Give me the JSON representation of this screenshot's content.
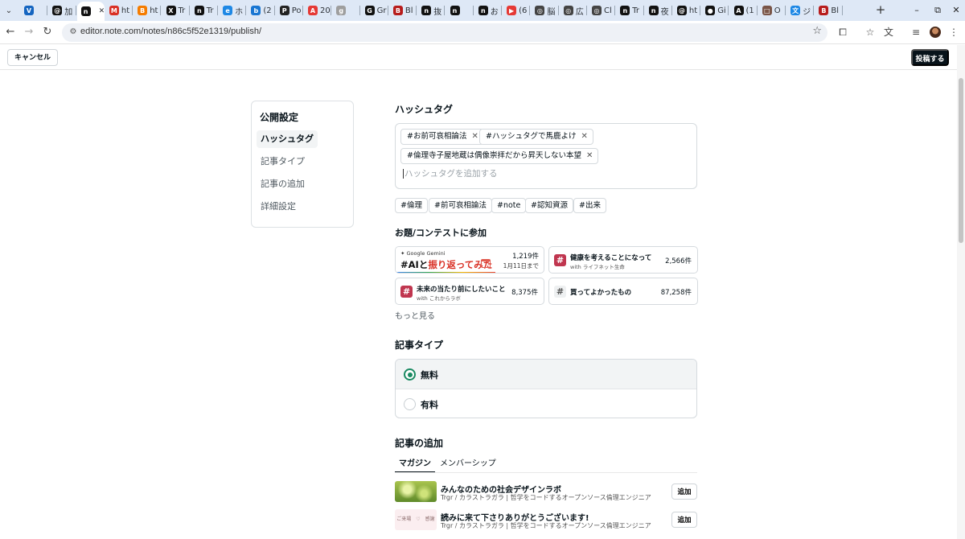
{
  "browser": {
    "tabs": [
      {
        "label": "",
        "icon": "vpn-icon",
        "color": "#1565c0",
        "glyph": "V"
      },
      {
        "label": "加",
        "icon": "threads-icon",
        "color": "#111111",
        "glyph": "@"
      },
      {
        "label": "",
        "icon": "note-icon",
        "color": "#111111",
        "glyph": "n",
        "active": true
      },
      {
        "label": "ht",
        "icon": "gmail-icon",
        "color": "#d93025",
        "glyph": "M"
      },
      {
        "label": "ht",
        "icon": "blogger-icon",
        "color": "#f57c00",
        "glyph": "B"
      },
      {
        "label": "Tr",
        "icon": "x-icon",
        "color": "#111111",
        "glyph": "X"
      },
      {
        "label": "Tr",
        "icon": "note-icon",
        "color": "#111111",
        "glyph": "n"
      },
      {
        "label": "ホ",
        "icon": "edge-icon",
        "color": "#1e88e5",
        "glyph": "e"
      },
      {
        "label": "(2",
        "icon": "bluesky-icon",
        "color": "#1976d2",
        "glyph": "b"
      },
      {
        "label": "Po",
        "icon": "perplexity-icon",
        "color": "#222222",
        "glyph": "P"
      },
      {
        "label": "20",
        "icon": "app-icon",
        "color": "#e53935",
        "glyph": "A"
      },
      {
        "label": "",
        "icon": "globe-icon",
        "color": "#9e9e9e",
        "glyph": "g"
      },
      {
        "label": "Gr",
        "icon": "grok-icon",
        "color": "#111111",
        "glyph": "G"
      },
      {
        "label": "Bl",
        "icon": "bookmark-icon",
        "color": "#b71c1c",
        "glyph": "B"
      },
      {
        "label": "抜",
        "icon": "note-icon",
        "color": "#111111",
        "glyph": "n"
      },
      {
        "label": "",
        "icon": "note-icon",
        "color": "#111111",
        "glyph": "n"
      },
      {
        "label": "お",
        "icon": "note-icon",
        "color": "#111111",
        "glyph": "n"
      },
      {
        "label": "(6",
        "icon": "youtube-icon",
        "color": "#e53935",
        "glyph": "▶"
      },
      {
        "label": "脳",
        "icon": "openai-icon",
        "color": "#444444",
        "glyph": "◎"
      },
      {
        "label": "広",
        "icon": "openai-icon",
        "color": "#444444",
        "glyph": "◎"
      },
      {
        "label": "Cl",
        "icon": "openai-icon",
        "color": "#444444",
        "glyph": "◎"
      },
      {
        "label": "Tr",
        "icon": "note-icon",
        "color": "#111111",
        "glyph": "n"
      },
      {
        "label": "夜",
        "icon": "note-icon",
        "color": "#111111",
        "glyph": "n"
      },
      {
        "label": "ht",
        "icon": "threads-icon",
        "color": "#111111",
        "glyph": "@"
      },
      {
        "label": "Gi",
        "icon": "github-icon",
        "color": "#111111",
        "glyph": "●"
      },
      {
        "label": "(1",
        "icon": "font-a-icon",
        "color": "#111111",
        "glyph": "A"
      },
      {
        "label": "O",
        "icon": "book-icon",
        "color": "#795548",
        "glyph": "□"
      },
      {
        "label": "ジ",
        "icon": "translate-icon",
        "color": "#1e88e5",
        "glyph": "文"
      },
      {
        "label": "Bl",
        "icon": "bookmark-icon",
        "color": "#b71c1c",
        "glyph": "B"
      }
    ],
    "url": "editor.note.com/notes/n86c5f52e1319/publish/"
  },
  "header": {
    "cancel_label": "キャンセル",
    "publish_label": "投稿する"
  },
  "nav": {
    "title": "公開設定",
    "items": [
      {
        "label": "ハッシュタグ",
        "active": true
      },
      {
        "label": "記事タイプ"
      },
      {
        "label": "記事の追加"
      },
      {
        "label": "詳細設定"
      }
    ]
  },
  "hashtags": {
    "title": "ハッシュタグ",
    "selected": [
      "#お前可哀相論法",
      "#ハッシュタグで馬鹿よけ",
      "#倫理寺子屋地蔵は偶像崇拝だから昇天しない本望"
    ],
    "placeholder": "ハッシュタグを追加する",
    "suggestions": [
      "#倫理",
      "#前可哀相論法",
      "#note",
      "#認知資源",
      "#出来"
    ]
  },
  "contests": {
    "title": "お題/コンテストに参加",
    "featured": {
      "logo_text": "✦ Google Gemini",
      "headline_pre": "#AIと",
      "headline_em": "振り返ってみた",
      "count": "1,219件",
      "deadline": "1月11日まで"
    },
    "items": [
      {
        "title": "健康を考えることになって",
        "sub": "with ライフネット生命",
        "count": "2,566件",
        "color": "#c0364f"
      },
      {
        "title": "未来の当たり前にしたいこと",
        "sub": "with これからラボ",
        "count": "8,375件",
        "color": "#c0364f"
      },
      {
        "title": "買ってよかったもの",
        "sub": "",
        "count": "87,258件",
        "color": "#eef0f1"
      }
    ],
    "more_label": "もっと見る"
  },
  "article_type": {
    "title": "記事タイプ",
    "options": [
      {
        "label": "無料",
        "selected": true
      },
      {
        "label": "有料",
        "selected": false
      }
    ]
  },
  "add_article": {
    "title": "記事の追加",
    "tabs": [
      {
        "label": "マガジン",
        "active": true
      },
      {
        "label": "メンバーシップ"
      }
    ],
    "magazines": [
      {
        "name": "みんなのための社会デザインラボ",
        "author": "Trgr / カラストラガラ | 哲学をコードするオープンソース倫理エンジニア",
        "add_label": "追加"
      },
      {
        "name": "読みに来て下さりありがとうございます!",
        "author": "Trgr / カラストラガラ | 哲学をコードするオープンソース倫理エンジニア",
        "add_label": "追加",
        "thumb_text": "ご来場　♡　感謝"
      }
    ]
  }
}
